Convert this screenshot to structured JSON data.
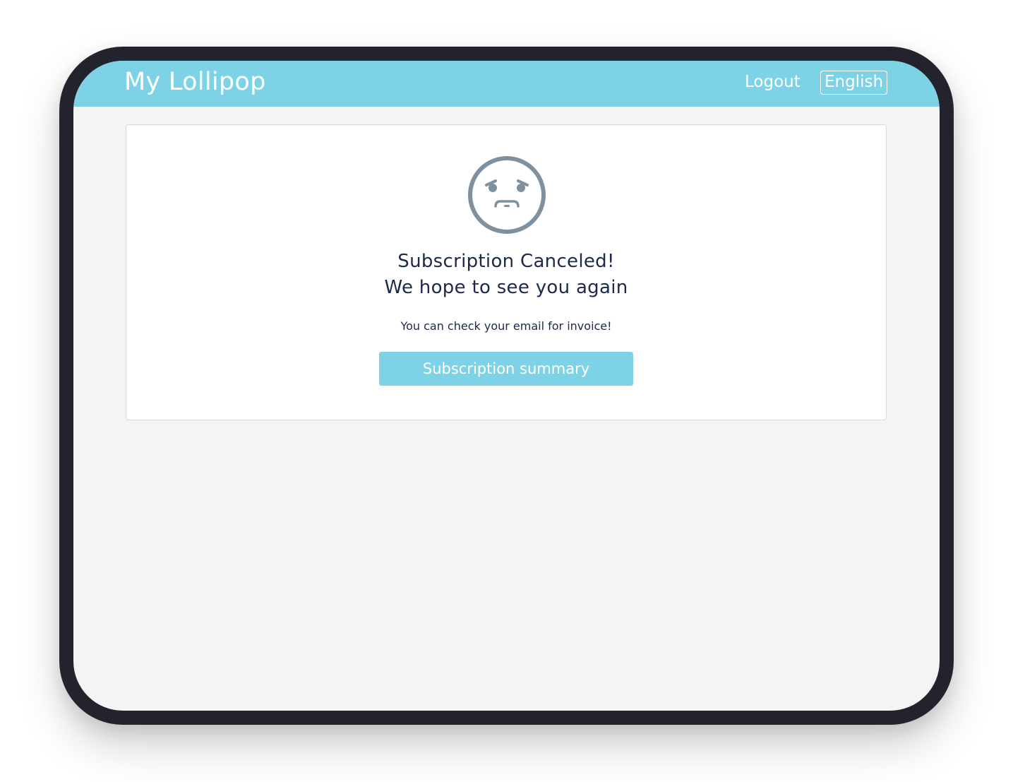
{
  "header": {
    "brand": "My Lollipop",
    "logout_label": "Logout",
    "language_label": "English"
  },
  "main": {
    "icon": "sad-face-icon",
    "title_line1": "Subscription Canceled!",
    "title_line2": "We hope to see you again",
    "message": "You can check your email for invoice!",
    "button_label": "Subscription summary"
  },
  "colors": {
    "accent": "#7dd3e5",
    "text": "#1b2a4a",
    "icon": "#7f909f",
    "frame": "#23232e",
    "background": "#f4f4f4"
  }
}
